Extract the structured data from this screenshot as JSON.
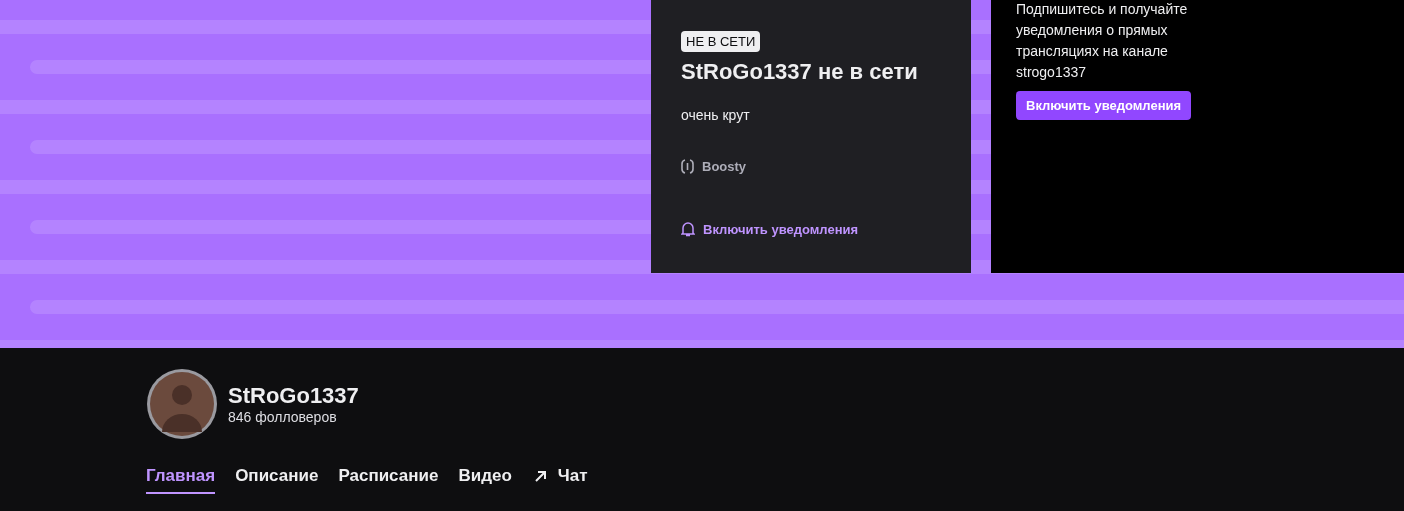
{
  "offline_card": {
    "badge": "НЕ В СЕТИ",
    "title": "StRoGo1337 не в сети",
    "description": "очень крут",
    "link": "Boosty",
    "notify_link": "Включить уведомления"
  },
  "notify_panel": {
    "text": "Подпишитесь и получайте уведомления о прямых трансляциях на канале strogo1337",
    "button": "Включить уведомления"
  },
  "channel": {
    "name": "StRoGo1337",
    "followers": "846 фолловеров"
  },
  "tabs": [
    {
      "label": "Главная",
      "selected": true,
      "external": false
    },
    {
      "label": "Описание",
      "selected": false,
      "external": false
    },
    {
      "label": "Расписание",
      "selected": false,
      "external": false
    },
    {
      "label": "Видео",
      "selected": false,
      "external": false
    },
    {
      "label": "Чат",
      "selected": false,
      "external": true
    }
  ]
}
